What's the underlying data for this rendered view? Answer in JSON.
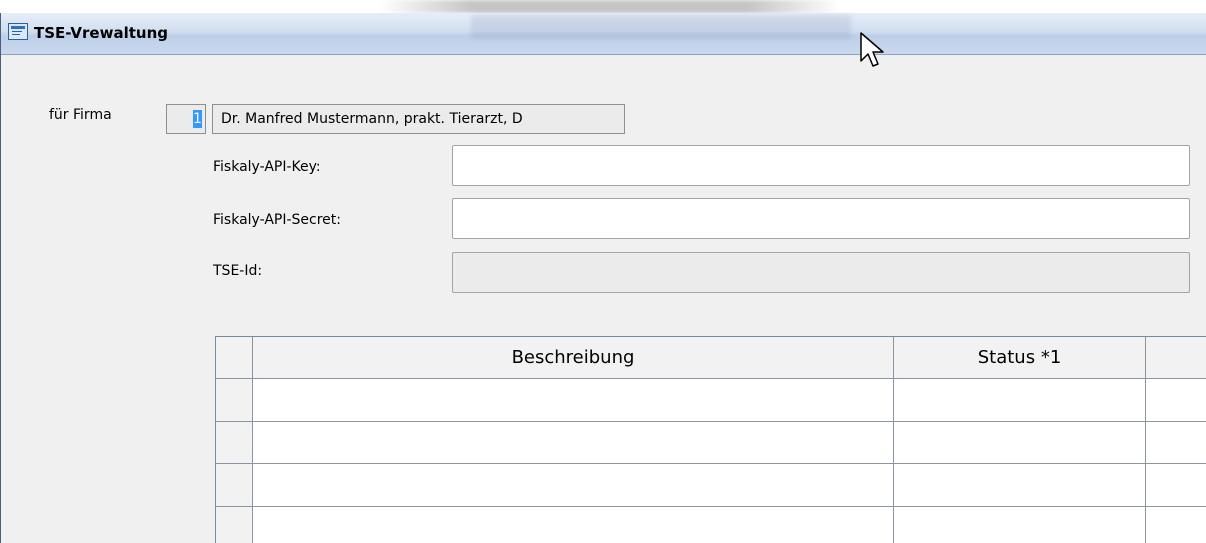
{
  "window": {
    "title": "TSE-Vrewaltung"
  },
  "form": {
    "firma_label": "für Firma",
    "firma_number": "1",
    "firma_name": "Dr. Manfred Mustermann, prakt. Tierarzt, D",
    "api_key_label": "Fiskaly-API-Key:",
    "api_key_value": "",
    "api_secret_label": "Fiskaly-API-Secret:",
    "api_secret_value": "",
    "tse_id_label": "TSE-Id:",
    "tse_id_value": ""
  },
  "grid": {
    "columns": [
      "Beschreibung",
      "Status *1"
    ],
    "rows": [
      [
        "",
        ""
      ],
      [
        "",
        ""
      ],
      [
        "",
        ""
      ],
      [
        "",
        ""
      ]
    ]
  }
}
